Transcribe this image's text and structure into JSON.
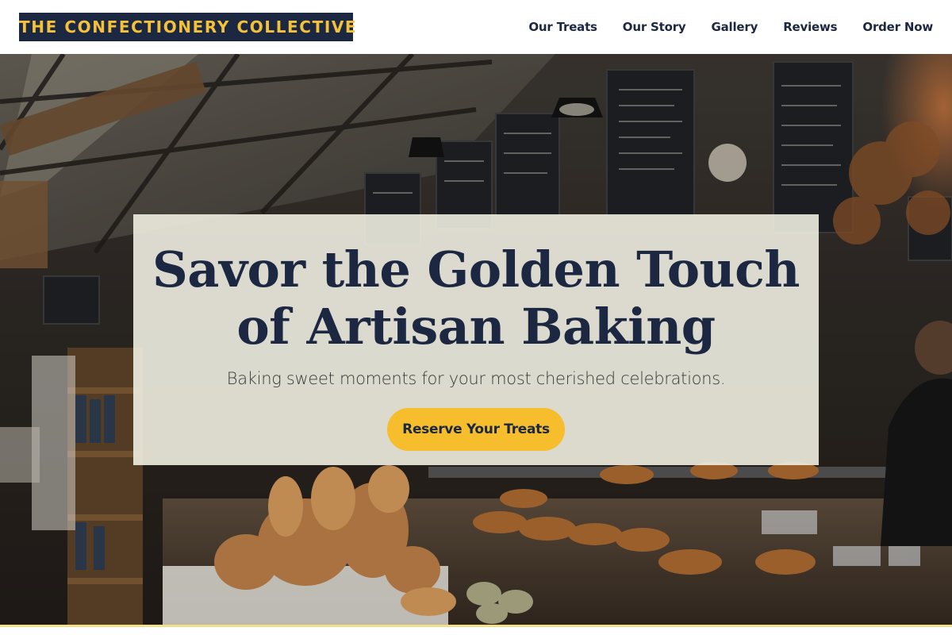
{
  "header": {
    "logo": "THE CONFECTIONERY COLLECTIVE",
    "nav": [
      {
        "label": "Our Treats"
      },
      {
        "label": "Our Story"
      },
      {
        "label": "Gallery"
      },
      {
        "label": "Reviews"
      },
      {
        "label": "Order Now"
      }
    ]
  },
  "hero": {
    "title_line1": "Savor the Golden Touch",
    "title_line2": "of Artisan Baking",
    "subtitle": "Baking sweet moments for your most cherished celebrations.",
    "cta_label": "Reserve Your Treats"
  },
  "colors": {
    "navy": "#1c2742",
    "gold": "#f4c23a",
    "cta": "#f6bd2c",
    "panel": "#f0eee1"
  }
}
